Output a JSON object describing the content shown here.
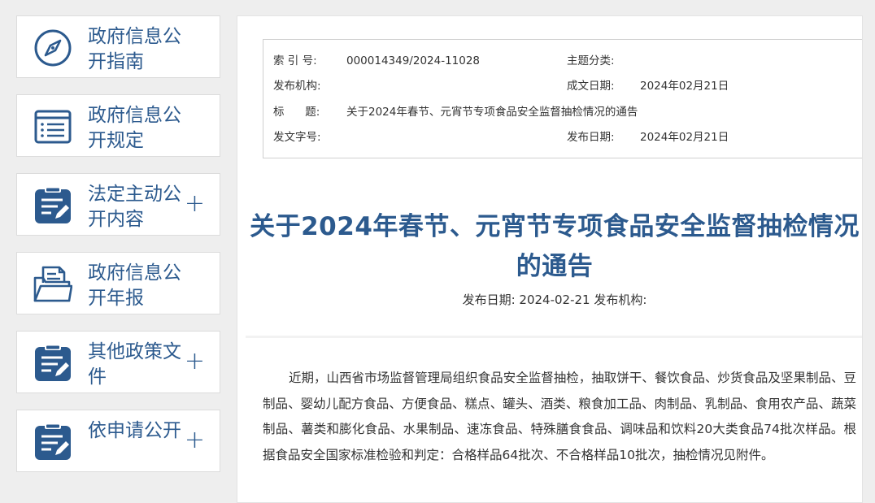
{
  "sidebar": {
    "items": [
      {
        "label": "政府信息公开指南",
        "icon": "compass-icon",
        "expandable": false
      },
      {
        "label": "政府信息公开规定",
        "icon": "list-document-icon",
        "expandable": false
      },
      {
        "label": "法定主动公开内容",
        "icon": "clipboard-edit-icon",
        "expandable": true,
        "expand_symbol": "+"
      },
      {
        "label": "政府信息公开年报",
        "icon": "folder-document-icon",
        "expandable": false
      },
      {
        "label": "其他政策文件",
        "icon": "clipboard-edit-icon",
        "expandable": true,
        "expand_symbol": "+"
      },
      {
        "label": "依申请公开",
        "icon": "clipboard-edit-icon",
        "expandable": true,
        "expand_symbol": "+"
      }
    ]
  },
  "meta": {
    "index_label": "索 引 号:",
    "index_value": "000014349/2024-11028",
    "topic_label": "主题分类:",
    "topic_value": "",
    "publisher_label": "发布机构:",
    "publisher_value": "",
    "created_label": "成文日期:",
    "created_value": "2024年02月21日",
    "title_label": "标      题:",
    "title_value": "关于2024年春节、元宵节专项食品安全监督抽检情况的通告",
    "docno_label": "发文字号:",
    "docno_value": "",
    "published_label": "发布日期:",
    "published_value": "2024年02月21日"
  },
  "article": {
    "title": "关于2024年春节、元宵节专项食品安全监督抽检情况的通告",
    "pub_line": "发布日期: 2024-02-21 发布机构:",
    "body": "近期，山西省市场监督管理局组织食品安全监督抽检，抽取饼干、餐饮食品、炒货食品及坚果制品、豆制品、婴幼儿配方食品、方便食品、糕点、罐头、酒类、粮食加工品、肉制品、乳制品、食用农产品、蔬菜制品、薯类和膨化食品、水果制品、速冻食品、特殊膳食食品、调味品和饮料20大类食品74批次样品。根据食品安全国家标准检验和判定：合格样品64批次、不合格样品10批次，抽检情况见附件。"
  },
  "colors": {
    "accent": "#2c5a8e",
    "background": "#eeeeee",
    "text": "#333333"
  }
}
